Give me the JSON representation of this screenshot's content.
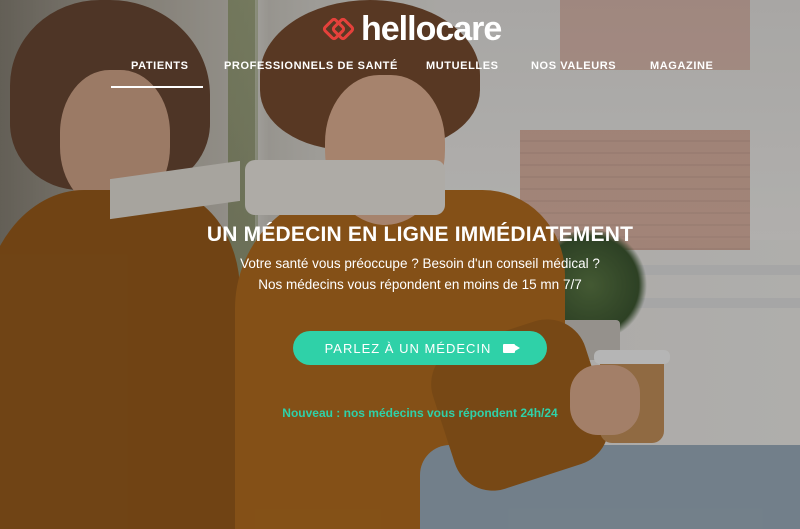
{
  "brand": {
    "name": "hellocare",
    "accent": "#2fd1a8",
    "logo_color": "#e5413b"
  },
  "nav": {
    "items": [
      {
        "label": "PATIENTS",
        "active": true
      },
      {
        "label": "PROFESSIONNELS DE SANTÉ",
        "active": false
      },
      {
        "label": "MUTUELLES",
        "active": false
      },
      {
        "label": "NOS VALEURS",
        "active": false
      },
      {
        "label": "MAGAZINE",
        "active": false
      }
    ]
  },
  "hero": {
    "title": "UN MÉDECIN EN LIGNE IMMÉDIATEMENT",
    "subtitle_line1": "Votre santé vous préoccupe ? Besoin d'un conseil médical ?",
    "subtitle_line2": "Nos médecins vous répondent en moins de 15 mn 7/7",
    "cta_label": "PARLEZ À UN MÉDECIN",
    "cta_icon": "video-camera-icon",
    "news": "Nouveau : nos médecins vous répondent 24h/24"
  }
}
